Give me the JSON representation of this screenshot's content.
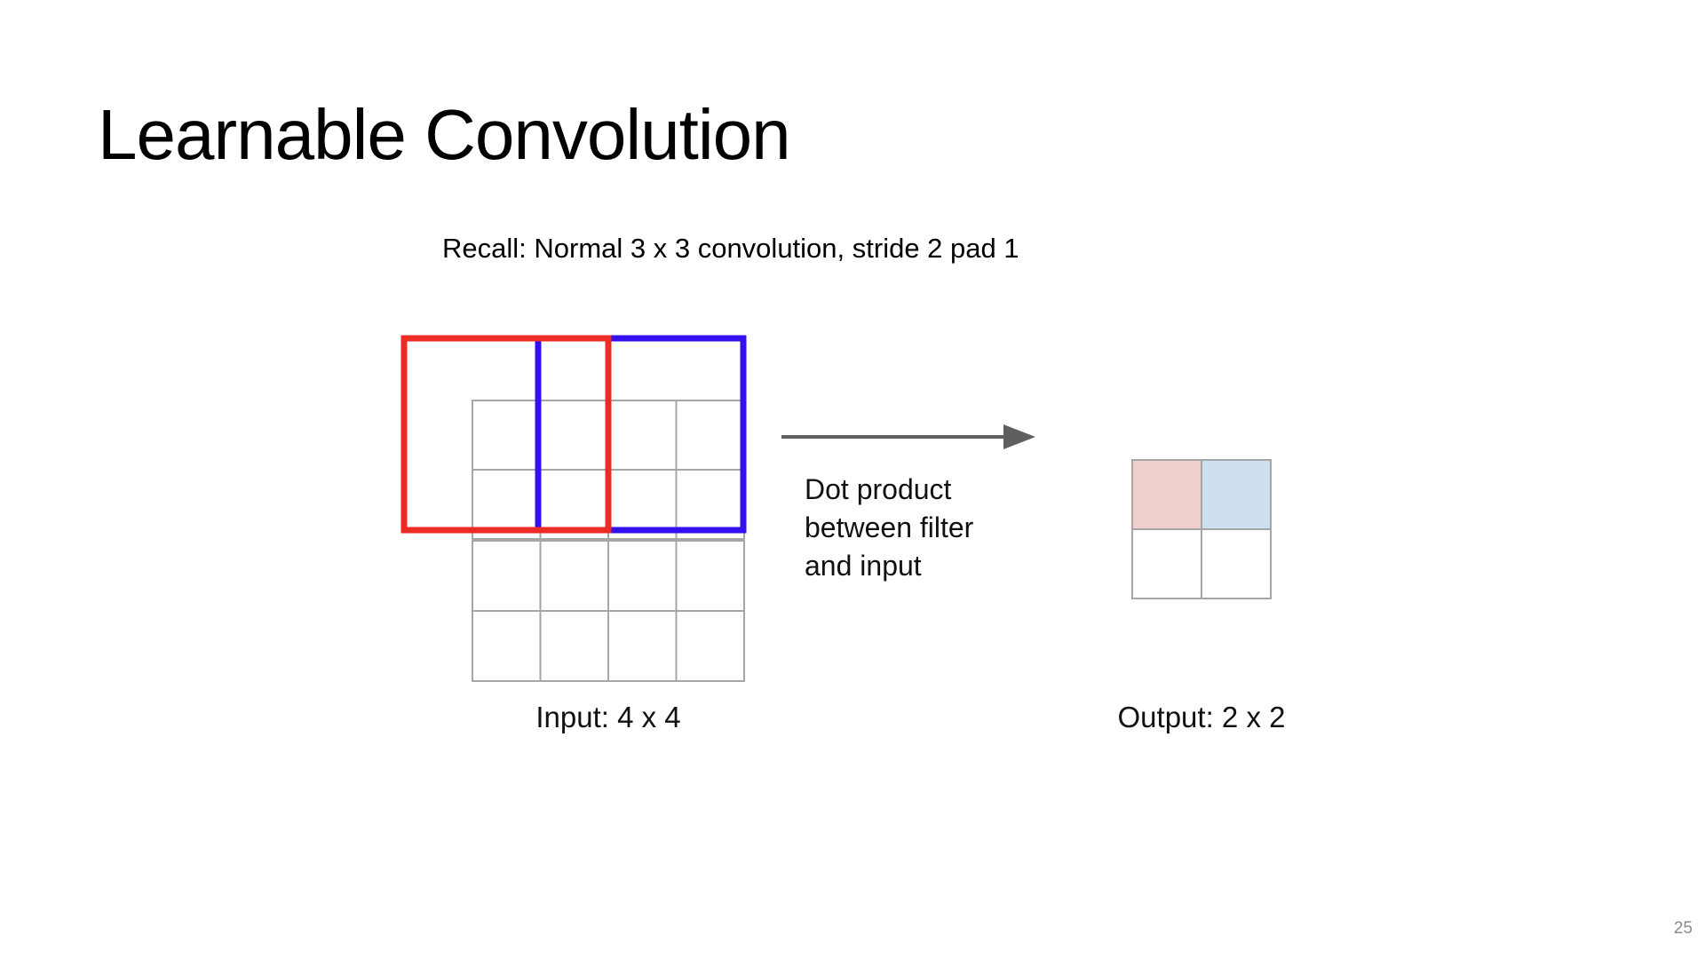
{
  "slide": {
    "title": "Learnable Convolution",
    "subtitle": "Recall: Normal 3 x 3 convolution, stride 2 pad 1",
    "page_number": "25"
  },
  "diagram": {
    "input_label": "Input: 4 x 4",
    "output_label": "Output: 2 x 2",
    "arrow_label_lines": [
      "Dot product",
      "between filter",
      "and input"
    ],
    "input_grid": {
      "rows": 4,
      "cols": 4
    },
    "output_grid": {
      "rows": 2,
      "cols": 2
    },
    "filter_size": 3,
    "stride": 2,
    "padding": 1,
    "colors": {
      "filter_first": "#ee2a24",
      "filter_second": "#3311ee",
      "output_cell_first": "#f0cfcf",
      "output_cell_second": "#cfdff0",
      "grid_line": "#a6a6a6",
      "arrow": "#5f5f5f"
    }
  }
}
